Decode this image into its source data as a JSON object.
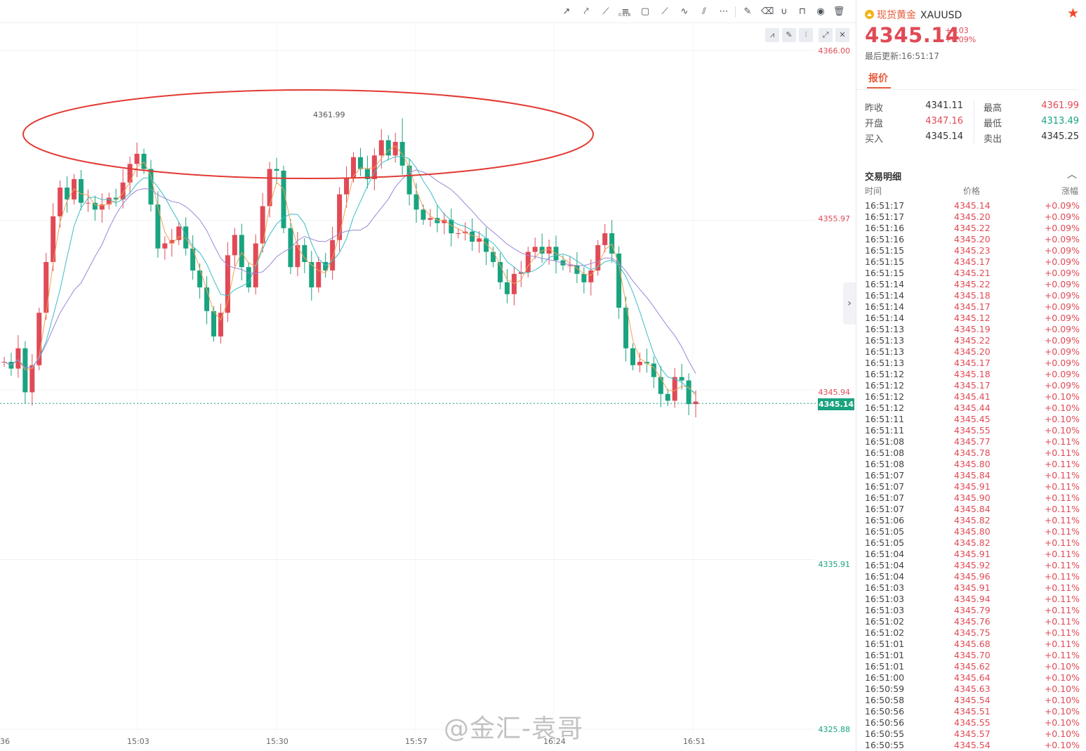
{
  "chart": {
    "price_axis": [
      "4366.00",
      "4355.97",
      "4345.94",
      "4335.91",
      "4325.88"
    ],
    "current_price": "4345.14",
    "time_axis": [
      "36",
      "15:03",
      "15:30",
      "15:57",
      "16:24",
      "16:51"
    ],
    "peak_label": "4361.99",
    "watermark": "@金汇-袁哥",
    "colors": {
      "up": "#e04a56",
      "down": "#19a37f",
      "ma1": "#f2a255",
      "ma2": "#3bbcc5",
      "ma3": "#9b86d6",
      "ellipse": "#e23a32"
    },
    "toolbar_icons": [
      "trend-line-icon",
      "ray-icon",
      "extended-line-icon",
      "fibonacci-icon",
      "rectangle-icon",
      "parallel-channel-icon",
      "polyline-icon",
      "pitchfork-icon",
      "more-icon",
      "note-icon",
      "eraser-icon",
      "magnet-icon",
      "lock-icon",
      "eye-icon",
      "trash-icon"
    ],
    "fib_label": "0.618",
    "mini_buttons": [
      "chart-type-icon",
      "draw-icon",
      "indicator-icon",
      "fullscreen-icon",
      "close-icon"
    ]
  },
  "chart_data": {
    "type": "candlestick",
    "y_range": [
      4325.88,
      4366.0
    ],
    "x_ticks": [
      "36",
      "15:03",
      "15:30",
      "15:57",
      "16:24",
      "16:51"
    ],
    "peak": 4361.99,
    "last": 4345.14
  },
  "quote": {
    "symbol_name": "现货黄金",
    "symbol_code": "XAUUSD",
    "last_price": "4345.14",
    "change_abs": "+4.03",
    "change_pct": "+0.09%",
    "update_time": "最后更新:16:51:17",
    "tab": "报价",
    "stats": {
      "prev_close_label": "昨收",
      "prev_close": "4341.11",
      "high_label": "最高",
      "high": "4361.99",
      "open_label": "开盘",
      "open": "4347.16",
      "low_label": "最低",
      "low": "4313.49",
      "bid_label": "买入",
      "bid": "4345.14",
      "ask_label": "卖出",
      "ask": "4345.25"
    }
  },
  "trades": {
    "title": "交易明细",
    "headers": {
      "time": "时间",
      "price": "价格",
      "pct": "涨幅"
    },
    "rows": [
      [
        "16:51:17",
        "4345.14",
        "+0.09%"
      ],
      [
        "16:51:17",
        "4345.20",
        "+0.09%"
      ],
      [
        "16:51:16",
        "4345.22",
        "+0.09%"
      ],
      [
        "16:51:16",
        "4345.20",
        "+0.09%"
      ],
      [
        "16:51:15",
        "4345.23",
        "+0.09%"
      ],
      [
        "16:51:15",
        "4345.17",
        "+0.09%"
      ],
      [
        "16:51:15",
        "4345.21",
        "+0.09%"
      ],
      [
        "16:51:14",
        "4345.22",
        "+0.09%"
      ],
      [
        "16:51:14",
        "4345.18",
        "+0.09%"
      ],
      [
        "16:51:14",
        "4345.17",
        "+0.09%"
      ],
      [
        "16:51:14",
        "4345.12",
        "+0.09%"
      ],
      [
        "16:51:13",
        "4345.19",
        "+0.09%"
      ],
      [
        "16:51:13",
        "4345.22",
        "+0.09%"
      ],
      [
        "16:51:13",
        "4345.20",
        "+0.09%"
      ],
      [
        "16:51:13",
        "4345.17",
        "+0.09%"
      ],
      [
        "16:51:12",
        "4345.18",
        "+0.09%"
      ],
      [
        "16:51:12",
        "4345.17",
        "+0.09%"
      ],
      [
        "16:51:12",
        "4345.41",
        "+0.10%"
      ],
      [
        "16:51:12",
        "4345.44",
        "+0.10%"
      ],
      [
        "16:51:11",
        "4345.45",
        "+0.10%"
      ],
      [
        "16:51:11",
        "4345.55",
        "+0.10%"
      ],
      [
        "16:51:08",
        "4345.77",
        "+0.11%"
      ],
      [
        "16:51:08",
        "4345.78",
        "+0.11%"
      ],
      [
        "16:51:08",
        "4345.80",
        "+0.11%"
      ],
      [
        "16:51:07",
        "4345.84",
        "+0.11%"
      ],
      [
        "16:51:07",
        "4345.91",
        "+0.11%"
      ],
      [
        "16:51:07",
        "4345.90",
        "+0.11%"
      ],
      [
        "16:51:07",
        "4345.84",
        "+0.11%"
      ],
      [
        "16:51:06",
        "4345.82",
        "+0.11%"
      ],
      [
        "16:51:05",
        "4345.80",
        "+0.11%"
      ],
      [
        "16:51:05",
        "4345.82",
        "+0.11%"
      ],
      [
        "16:51:04",
        "4345.91",
        "+0.11%"
      ],
      [
        "16:51:04",
        "4345.92",
        "+0.11%"
      ],
      [
        "16:51:04",
        "4345.96",
        "+0.11%"
      ],
      [
        "16:51:03",
        "4345.91",
        "+0.11%"
      ],
      [
        "16:51:03",
        "4345.94",
        "+0.11%"
      ],
      [
        "16:51:03",
        "4345.79",
        "+0.11%"
      ],
      [
        "16:51:02",
        "4345.76",
        "+0.11%"
      ],
      [
        "16:51:02",
        "4345.75",
        "+0.11%"
      ],
      [
        "16:51:01",
        "4345.68",
        "+0.11%"
      ],
      [
        "16:51:01",
        "4345.70",
        "+0.11%"
      ],
      [
        "16:51:01",
        "4345.62",
        "+0.10%"
      ],
      [
        "16:51:00",
        "4345.64",
        "+0.10%"
      ],
      [
        "16:50:59",
        "4345.63",
        "+0.10%"
      ],
      [
        "16:50:58",
        "4345.54",
        "+0.10%"
      ],
      [
        "16:50:56",
        "4345.51",
        "+0.10%"
      ],
      [
        "16:50:56",
        "4345.55",
        "+0.10%"
      ],
      [
        "16:50:55",
        "4345.57",
        "+0.10%"
      ],
      [
        "16:50:55",
        "4345.54",
        "+0.10%"
      ]
    ]
  }
}
